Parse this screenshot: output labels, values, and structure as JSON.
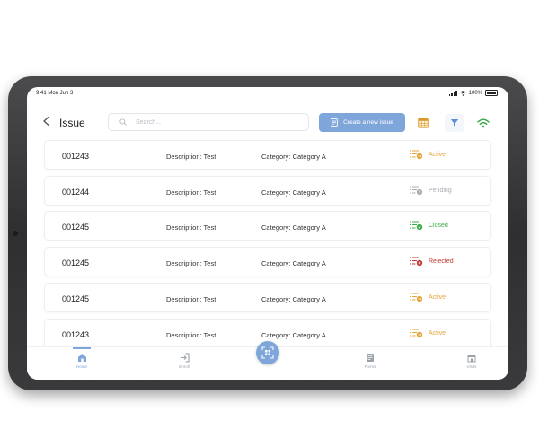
{
  "status_bar": {
    "time": "9:41  Mon Jun 3",
    "battery": "100%"
  },
  "header": {
    "title": "Issue",
    "search_placeholder": "Search...",
    "create_button_label": "Create a new issue",
    "icons": [
      "back-icon",
      "search-icon",
      "calendar-icon",
      "filter-icon",
      "wifi-icon"
    ]
  },
  "issues": [
    {
      "id": "001243",
      "description": "Description: Test",
      "category": "Category: Category A",
      "status": "Active",
      "color": "#e3a43b"
    },
    {
      "id": "001244",
      "description": "Description: Test",
      "category": "Category: Category A",
      "status": "Pending",
      "color": "#a9adb3"
    },
    {
      "id": "001245",
      "description": "Description: Test",
      "category": "Category: Category A",
      "status": "Closed",
      "color": "#3daa4a"
    },
    {
      "id": "001245",
      "description": "Description: Test",
      "category": "Category: Category A",
      "status": "Rejected",
      "color": "#c23a33"
    },
    {
      "id": "001245",
      "description": "Description: Test",
      "category": "Category: Category A",
      "status": "Active",
      "color": "#e3a43b"
    },
    {
      "id": "001243",
      "description": "Description: Test",
      "category": "Category: Category A",
      "status": "Active",
      "color": "#e3a43b"
    }
  ],
  "bottom_nav": {
    "items": [
      {
        "label": "Home",
        "icon": "home-icon",
        "active": true
      },
      {
        "label": "Enroll",
        "icon": "enroll-icon",
        "active": false
      },
      {
        "label": "Forms",
        "icon": "forms-icon",
        "active": false
      },
      {
        "label": "Visits",
        "icon": "visits-icon",
        "active": false
      }
    ],
    "scan_icon": "qr-scan-icon"
  },
  "colors": {
    "accent": "#7fa6da",
    "active": "#e3a43b",
    "pending": "#a9adb3",
    "closed": "#3daa4a",
    "rejected": "#c23a33",
    "wifi": "#3daa4a"
  }
}
